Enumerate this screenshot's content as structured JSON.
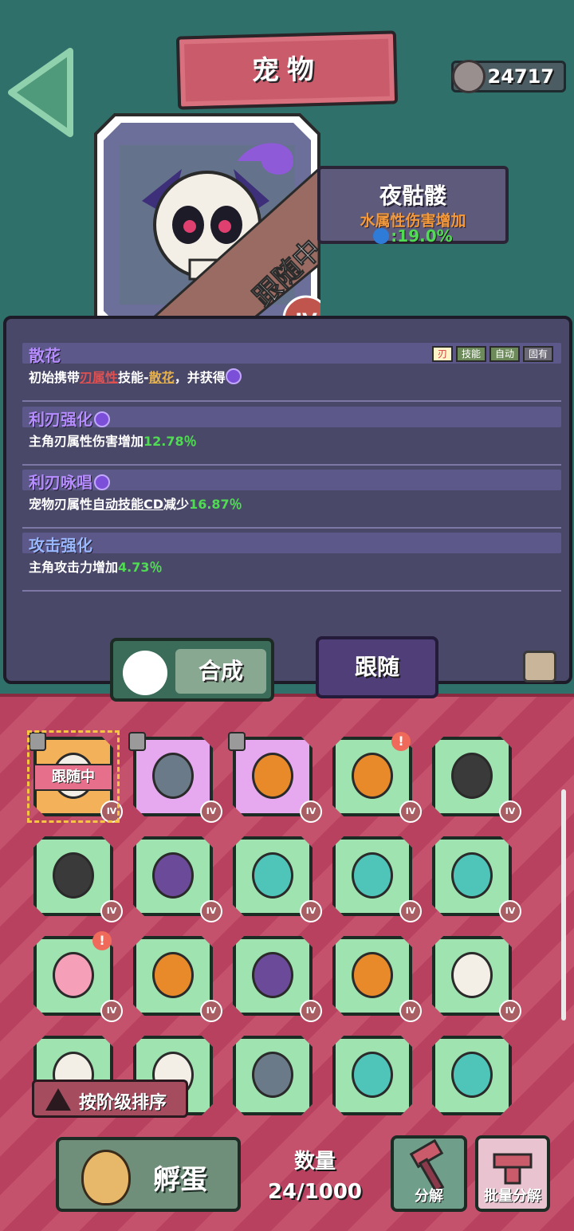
{
  "header": {
    "title": "宠物",
    "coins": "24717"
  },
  "pet": {
    "name": "夜骷髅",
    "attribute": "水属性伤害增加",
    "value": ":19.0%",
    "status": "跟随中",
    "tier": "IV"
  },
  "skills": [
    {
      "title": "散花",
      "desc_parts": [
        "初始携带",
        "刃属性",
        "技能-",
        "散花",
        "，并获得"
      ],
      "tags": [
        "刃",
        "技能",
        "自动",
        "固有"
      ]
    },
    {
      "title": "利刃强化",
      "desc_parts": [
        "主角刃属性伤害增加",
        "12.78％"
      ]
    },
    {
      "title": "利刃咏唱",
      "desc_parts": [
        "宠物刃属性",
        "自动技能CD",
        "减少",
        "16.87％"
      ]
    },
    {
      "title": "攻击强化",
      "desc_parts": [
        "主角攻击力增加",
        "4.73％"
      ]
    }
  ],
  "tabs": {
    "merge": "合成",
    "follow": "跟随"
  },
  "grid": {
    "tier": "IV",
    "follow_label": "跟随中",
    "items": [
      {
        "icon": "skull-pet-icon",
        "bg": "orange",
        "locked": true,
        "following": true,
        "alert": false
      },
      {
        "icon": "drone-pet-icon",
        "bg": "purple",
        "locked": true,
        "alert": false
      },
      {
        "icon": "pumpkin-pet-icon",
        "bg": "purple",
        "locked": true,
        "alert": false
      },
      {
        "icon": "pumpkin-pet-icon",
        "bg": "green",
        "locked": false,
        "alert": true
      },
      {
        "icon": "sword-pet-icon",
        "bg": "green",
        "locked": false,
        "alert": false
      },
      {
        "icon": "sword-pet-icon",
        "bg": "green",
        "locked": false,
        "alert": false
      },
      {
        "icon": "ghost-pet-icon",
        "bg": "green",
        "locked": false,
        "alert": false
      },
      {
        "icon": "spring-pet-icon",
        "bg": "green",
        "locked": false,
        "alert": false
      },
      {
        "icon": "spring-pet-icon",
        "bg": "green",
        "locked": false,
        "alert": false
      },
      {
        "icon": "spring-pet-icon",
        "bg": "green",
        "locked": false,
        "alert": false
      },
      {
        "icon": "fairy-pet-icon",
        "bg": "green",
        "locked": false,
        "alert": true
      },
      {
        "icon": "pumpkin-pet-icon",
        "bg": "green",
        "locked": false,
        "alert": false
      },
      {
        "icon": "ghost-pet-icon",
        "bg": "green",
        "locked": false,
        "alert": false
      },
      {
        "icon": "pumpkin-pet-icon",
        "bg": "green",
        "locked": false,
        "alert": false
      },
      {
        "icon": "skull-pet-icon",
        "bg": "green",
        "locked": false,
        "alert": false
      },
      {
        "icon": "skull-pet-icon",
        "bg": "green",
        "locked": false,
        "alert": false
      },
      {
        "icon": "skull-pet-icon",
        "bg": "green",
        "locked": false,
        "alert": false
      },
      {
        "icon": "drone-pet-icon",
        "bg": "green",
        "locked": false,
        "alert": false
      },
      {
        "icon": "spring-pet-icon",
        "bg": "green",
        "locked": false,
        "alert": false
      },
      {
        "icon": "spring-pet-icon",
        "bg": "green",
        "locked": false,
        "alert": false
      }
    ]
  },
  "bottom": {
    "sort": "按阶级排序",
    "hatch": "孵蛋",
    "count_label": "数量",
    "count_value": "24/1000",
    "decompose": "分解",
    "batch_decompose": "批量分解"
  }
}
